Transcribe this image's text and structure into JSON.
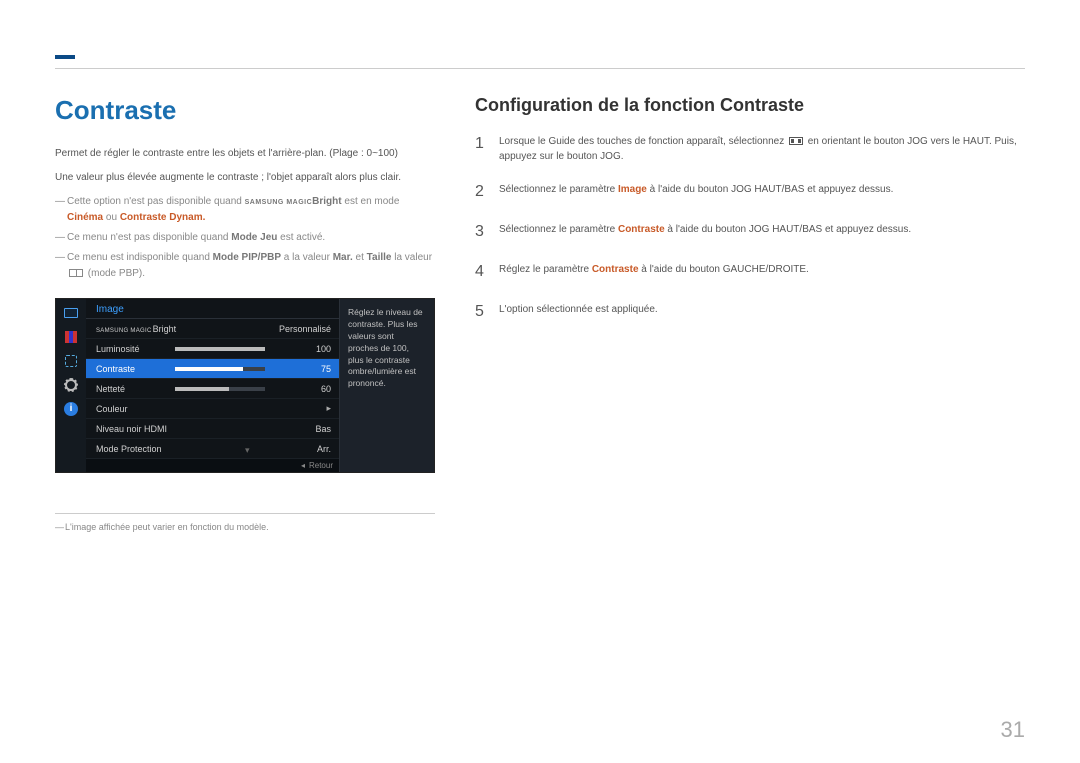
{
  "title": "Contraste",
  "intro1": "Permet de régler le contraste entre les objets et l'arrière-plan. (Plage : 0~100)",
  "intro2": "Une valeur plus élevée augmente le contraste ; l'objet apparaît alors plus clair.",
  "note1_a": "Cette option n'est pas disponible quand ",
  "note1_magic": "SAMSUNG MAGIC",
  "note1_bright": "Bright",
  "note1_b": " est en mode ",
  "note1_cinema": "Cinéma",
  "note1_c": " ou ",
  "note1_dynam": "Contraste Dynam.",
  "note2_a": "Ce menu n'est pas disponible quand ",
  "note2_mode": "Mode Jeu",
  "note2_b": " est activé.",
  "note3_a": "Ce menu est indisponible quand ",
  "note3_mode": "Mode PIP/PBP",
  "note3_b": " a la valeur ",
  "note3_mar": "Mar.",
  "note3_c": " et ",
  "note3_taille": "Taille",
  "note3_d": " la valeur ",
  "note3_e": " (mode PBP).",
  "osd": {
    "header": "Image",
    "desc": "Réglez le niveau de contraste. Plus les valeurs sont proches de 100, plus le contraste ombre/lumière est prononcé.",
    "rows": [
      {
        "label": "Bright",
        "prefix": "SAMSUNG MAGIC",
        "value": "Personnalisé",
        "bar": null
      },
      {
        "label": "Luminosité",
        "value": "100",
        "bar": 100
      },
      {
        "label": "Contraste",
        "value": "75",
        "bar": 75,
        "selected": true
      },
      {
        "label": "Netteté",
        "value": "60",
        "bar": 60
      },
      {
        "label": "Couleur",
        "value": "",
        "arrow": true
      },
      {
        "label": "Niveau noir HDMI",
        "value": "Bas"
      },
      {
        "label": "Mode Protection",
        "value": "Arr."
      }
    ],
    "return": "Retour"
  },
  "footnote": "L'image affichée peut varier en fonction du modèle.",
  "right": {
    "heading": "Configuration de la fonction Contraste",
    "steps": [
      {
        "n": "1",
        "a": "Lorsque le Guide des touches de fonction apparaît, sélectionnez ",
        "b": " en orientant le bouton JOG vers le HAUT. Puis, appuyez sur le bouton JOG.",
        "icon": true
      },
      {
        "n": "2",
        "a": "Sélectionnez le paramètre ",
        "accent": "Image",
        "b": " à l'aide du bouton JOG HAUT/BAS et appuyez dessus."
      },
      {
        "n": "3",
        "a": "Sélectionnez le paramètre ",
        "accent": "Contraste",
        "b": " à l'aide du bouton JOG HAUT/BAS et appuyez dessus."
      },
      {
        "n": "4",
        "a": "Réglez le paramètre ",
        "accent": "Contraste",
        "b": " à l'aide du bouton GAUCHE/DROITE."
      },
      {
        "n": "5",
        "a": "L'option sélectionnée est appliquée."
      }
    ]
  },
  "pagenum": "31"
}
